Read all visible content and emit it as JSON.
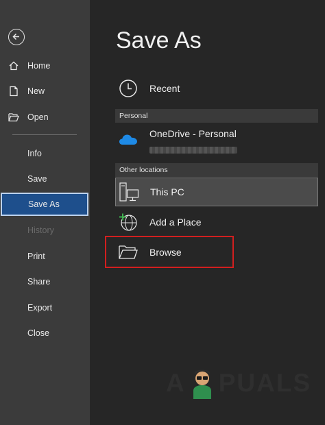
{
  "sidebar": {
    "items": [
      {
        "key": "home",
        "label": "Home",
        "icon": "home-icon"
      },
      {
        "key": "new",
        "label": "New",
        "icon": "new-document-icon"
      },
      {
        "key": "open",
        "label": "Open",
        "icon": "open-folder-icon"
      },
      {
        "key": "info",
        "label": "Info"
      },
      {
        "key": "save",
        "label": "Save"
      },
      {
        "key": "save-as",
        "label": "Save As",
        "active": true
      },
      {
        "key": "history",
        "label": "History",
        "disabled": true
      },
      {
        "key": "print",
        "label": "Print"
      },
      {
        "key": "share",
        "label": "Share"
      },
      {
        "key": "export",
        "label": "Export"
      },
      {
        "key": "close",
        "label": "Close"
      }
    ]
  },
  "main": {
    "title": "Save As",
    "recent_label": "Recent",
    "personal_header": "Personal",
    "onedrive_label": "OneDrive - Personal",
    "other_header": "Other locations",
    "this_pc_label": "This PC",
    "add_place_label": "Add a Place",
    "browse_label": "Browse"
  },
  "watermark": {
    "left": "A",
    "right": "PUALS"
  },
  "colors": {
    "sidebar_bg": "#3b3b3b",
    "main_bg": "#262626",
    "active_item": "#1e4f8c",
    "highlight_box": "#d21f1f",
    "onedrive_blue": "#1e8ae6"
  }
}
